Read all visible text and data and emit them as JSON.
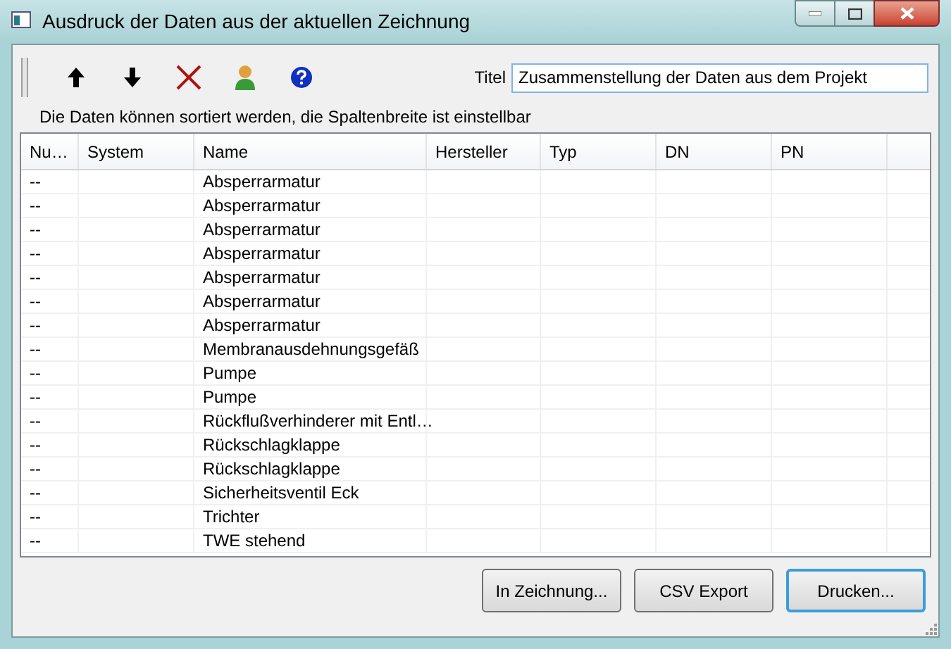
{
  "window": {
    "title": "Ausdruck der Daten aus der aktuellen Zeichnung"
  },
  "toolbar": {
    "tools": [
      {
        "kind": "up"
      },
      {
        "kind": "down"
      },
      {
        "kind": "delete"
      },
      {
        "kind": "user"
      },
      {
        "kind": "help"
      }
    ]
  },
  "title_field": {
    "label": "Titel",
    "value": "Zusammenstellung der Daten aus dem Projekt"
  },
  "hint": "Die Daten können sortiert werden, die Spaltenbreite ist einstellbar",
  "table": {
    "columns": [
      "Nu…",
      "System",
      "Name",
      "Hersteller",
      "Typ",
      "DN",
      "PN"
    ],
    "rows": [
      {
        "number": "--",
        "name": "Absperrarmatur"
      },
      {
        "number": "--",
        "name": "Absperrarmatur"
      },
      {
        "number": "--",
        "name": "Absperrarmatur"
      },
      {
        "number": "--",
        "name": "Absperrarmatur"
      },
      {
        "number": "--",
        "name": "Absperrarmatur"
      },
      {
        "number": "--",
        "name": "Absperrarmatur"
      },
      {
        "number": "--",
        "name": "Absperrarmatur"
      },
      {
        "number": "--",
        "name": "Membranausdehnungsgefäß"
      },
      {
        "number": "--",
        "name": "Pumpe"
      },
      {
        "number": "--",
        "name": "Pumpe"
      },
      {
        "number": "--",
        "name": "Rückflußverhinderer mit Entl…"
      },
      {
        "number": "--",
        "name": "Rückschlagklappe"
      },
      {
        "number": "--",
        "name": "Rückschlagklappe"
      },
      {
        "number": "--",
        "name": "Sicherheitsventil Eck"
      },
      {
        "number": "--",
        "name": "Trichter"
      },
      {
        "number": "--",
        "name": "TWE stehend"
      }
    ]
  },
  "buttons": [
    {
      "label": "In Zeichnung...",
      "default": false
    },
    {
      "label": "CSV Export",
      "default": false
    },
    {
      "label": "Drucken...",
      "default": true
    }
  ]
}
